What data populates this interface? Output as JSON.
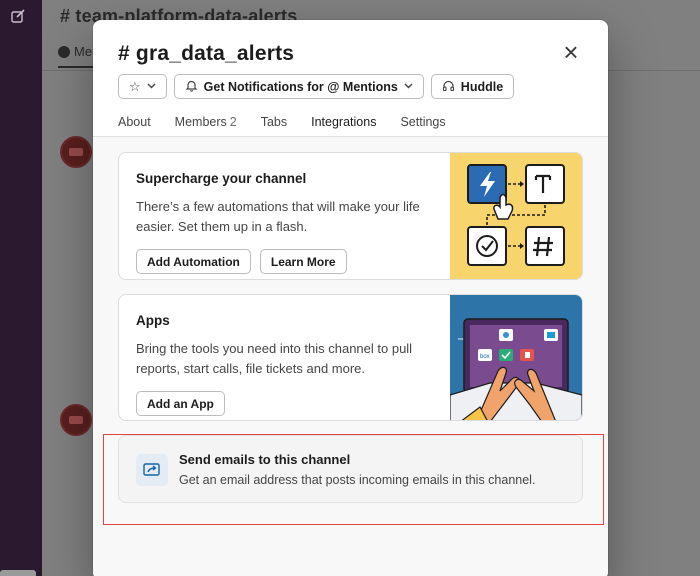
{
  "background": {
    "channel_title": "# team-platform-data-alerts",
    "tab_label": "Me"
  },
  "modal": {
    "title": "# gra_data_alerts",
    "close_glyph": "×",
    "header_buttons": {
      "star_glyph": "☆",
      "notifications_label": "Get Notifications for @ Mentions",
      "huddle_label": "Huddle"
    },
    "tabs": [
      {
        "label": "About"
      },
      {
        "label": "Members",
        "count": "2"
      },
      {
        "label": "Tabs"
      },
      {
        "label": "Integrations"
      },
      {
        "label": "Settings"
      }
    ],
    "active_tab": "Integrations",
    "cards": {
      "automation": {
        "title": "Supercharge your channel",
        "description": "There’s a few automations that will make your life easier. Set them up in a flash.",
        "primary_button": "Add Automation",
        "secondary_button": "Learn More"
      },
      "apps": {
        "title": "Apps",
        "description": "Bring the tools you need into this channel to pull reports, start calls, file tickets and more.",
        "button": "Add an App"
      },
      "email": {
        "title": "Send emails to this channel",
        "description": "Get an email address that posts incoming emails in this channel."
      }
    }
  },
  "colors": {
    "accent": "#7a1f74",
    "automation_art_bg": "#f8d46c",
    "apps_art_bg": "#2d74a8",
    "highlight_border": "#e0443c"
  }
}
